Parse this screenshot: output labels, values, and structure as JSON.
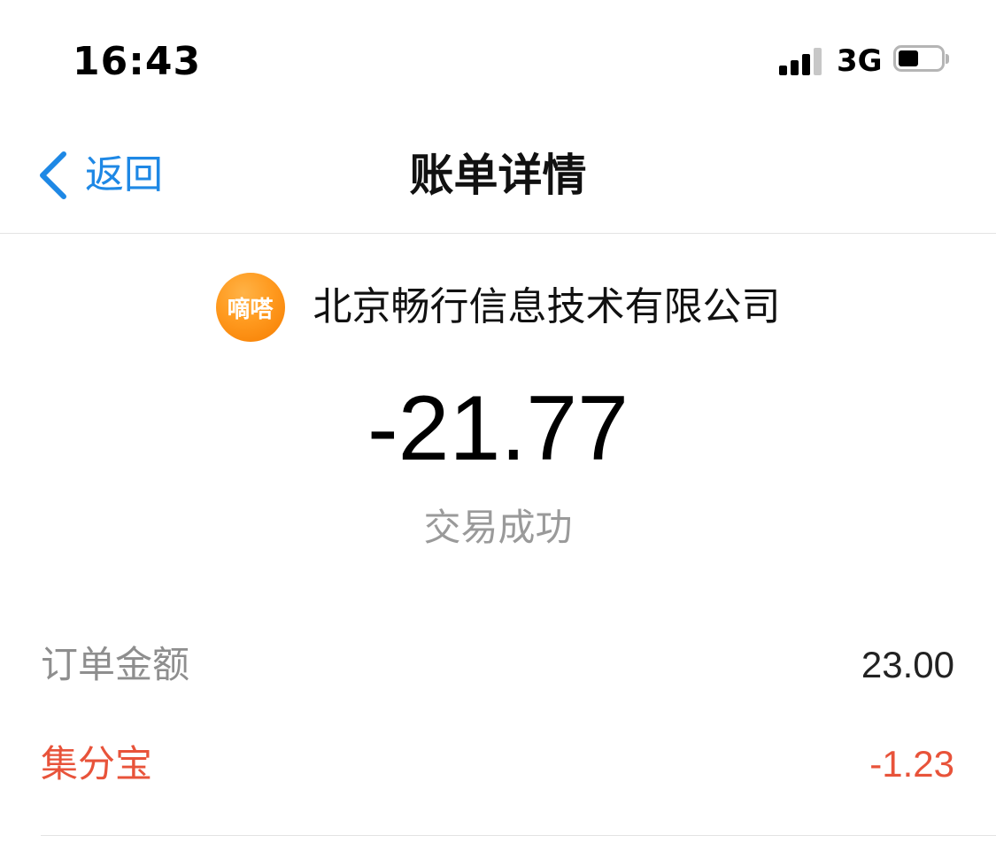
{
  "status_bar": {
    "time": "16:43",
    "network": "3G",
    "signal_bars_active": 3,
    "signal_bars_total": 4,
    "battery_level": 0.4
  },
  "nav": {
    "back_label": "返回",
    "title": "账单详情",
    "accent_color": "#1e88e5"
  },
  "merchant": {
    "logo_text": "嘀嗒",
    "logo_color": "#ff9a1f",
    "name": "北京畅行信息技术有限公司"
  },
  "transaction": {
    "amount": "-21.77",
    "status": "交易成功"
  },
  "details": [
    {
      "label": "订单金额",
      "value": "23.00"
    },
    {
      "label": "集分宝",
      "value": "-1.23",
      "color": "#e8533a"
    }
  ]
}
